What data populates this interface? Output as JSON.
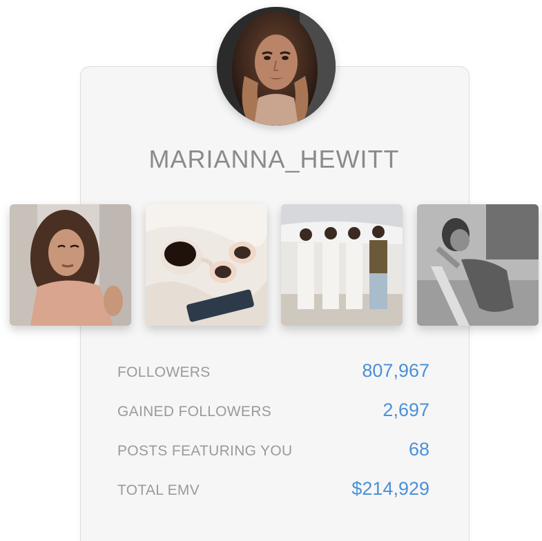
{
  "profile": {
    "username": "MARIANNA_HEWITT",
    "avatar_icon": "profile-photo"
  },
  "posts": [
    {
      "name": "selfie-photo"
    },
    {
      "name": "coffee-sunglasses-photo"
    },
    {
      "name": "group-airplane-photo"
    },
    {
      "name": "swimsuit-photo"
    }
  ],
  "stats": [
    {
      "label": "FOLLOWERS",
      "value": "807,967"
    },
    {
      "label": "GAINED FOLLOWERS",
      "value": "2,697"
    },
    {
      "label": "POSTS FEATURING YOU",
      "value": "68"
    },
    {
      "label": "TOTAL EMV",
      "value": "$214,929"
    }
  ],
  "colors": {
    "accent": "#4a90d9",
    "label": "#9a9a9a",
    "card_bg": "#f6f6f6"
  }
}
